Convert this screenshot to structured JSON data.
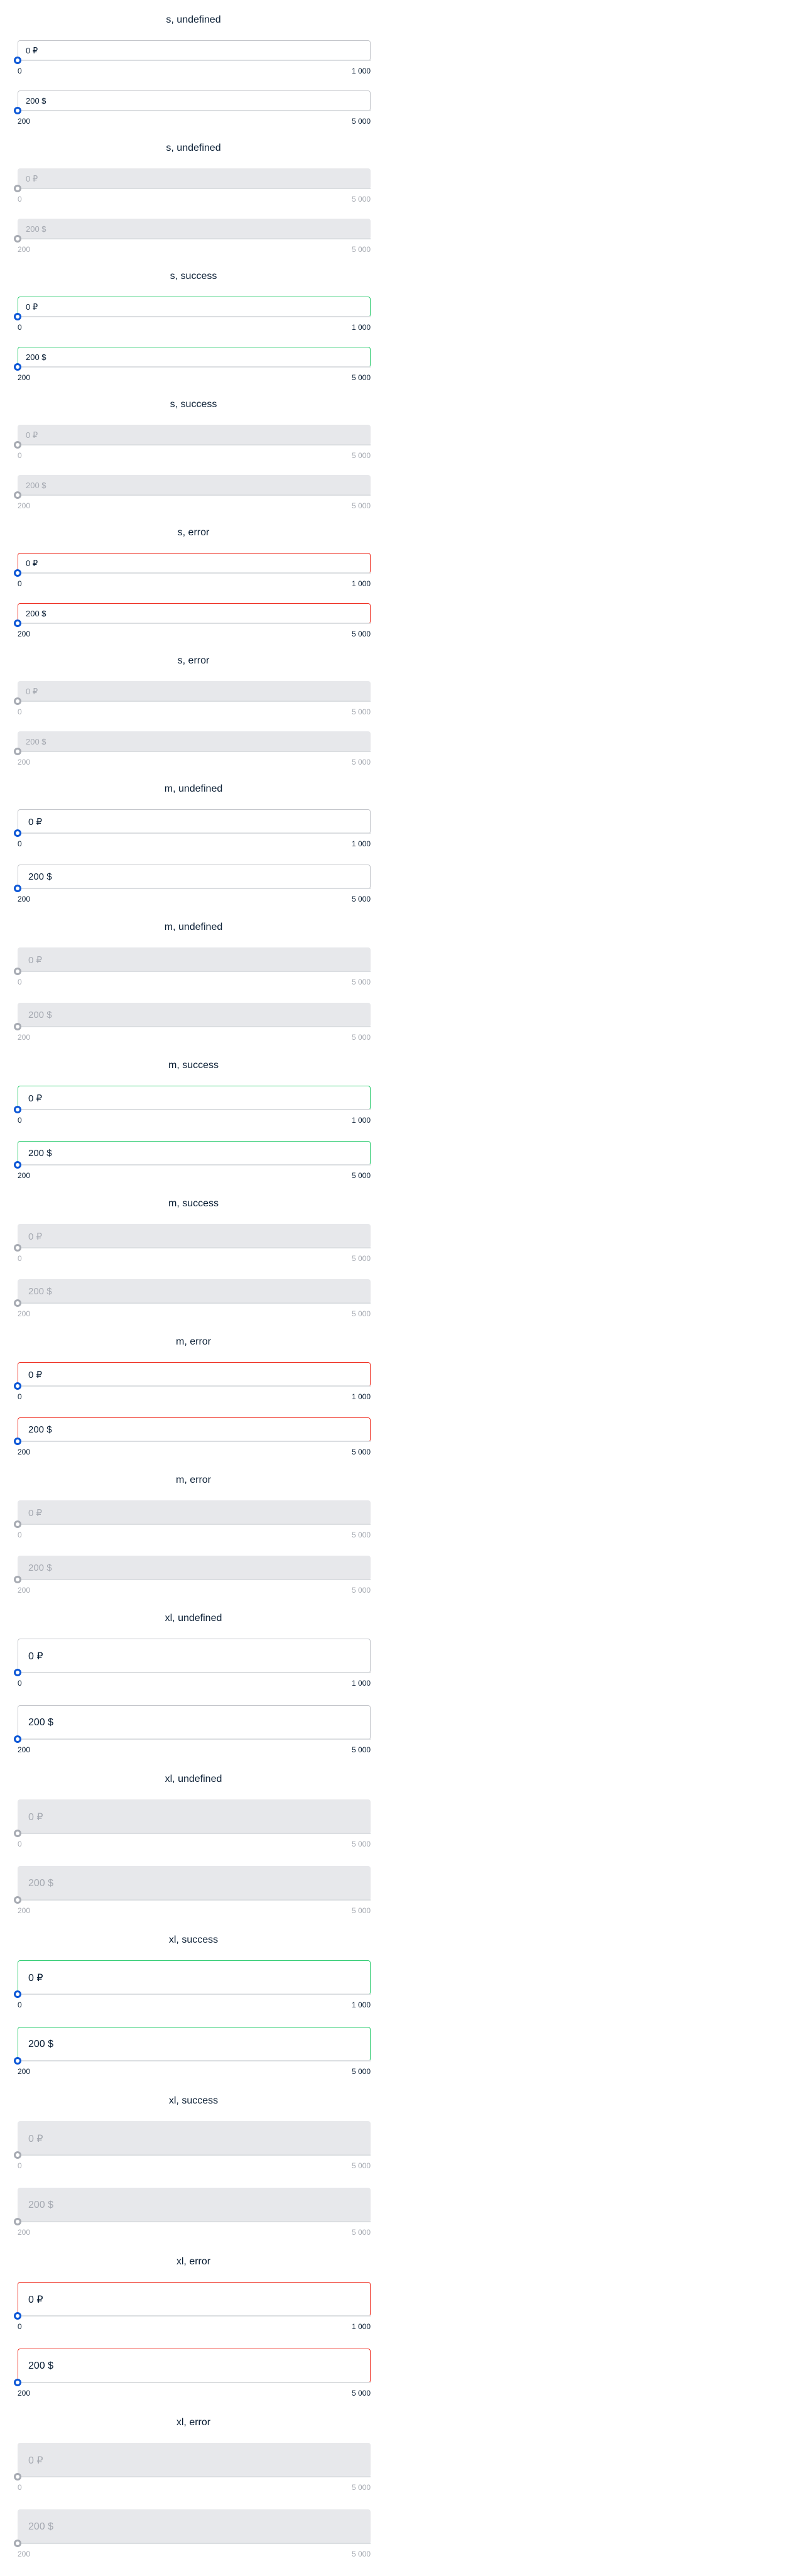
{
  "colors": {
    "text": "#0b1f35",
    "border": "#c4c6cb",
    "success_border": "#2ecc71",
    "error_border": "#ef3124",
    "disabled_bg": "#e7e8eb",
    "disabled_text": "#a6aab2",
    "thumb": "#0b56d6"
  },
  "sections": [
    {
      "title": "s, undefined",
      "size": "s",
      "status": "undefined",
      "disabled": false,
      "rows": [
        {
          "value": "0 ₽",
          "min_label": "0",
          "max_label": "1 000",
          "progress": 0
        },
        {
          "value": "200 $",
          "min_label": "200",
          "max_label": "5 000",
          "progress": 0
        }
      ]
    },
    {
      "title": "s, undefined",
      "size": "s",
      "status": "undefined",
      "disabled": true,
      "rows": [
        {
          "value": "0 ₽",
          "min_label": "0",
          "max_label": "5 000",
          "progress": 0
        },
        {
          "value": "200 $",
          "min_label": "200",
          "max_label": "5 000",
          "progress": 0
        }
      ]
    },
    {
      "title": "s, success",
      "size": "s",
      "status": "success",
      "disabled": false,
      "rows": [
        {
          "value": "0 ₽",
          "min_label": "0",
          "max_label": "1 000",
          "progress": 0
        },
        {
          "value": "200 $",
          "min_label": "200",
          "max_label": "5 000",
          "progress": 0
        }
      ]
    },
    {
      "title": "s, success",
      "size": "s",
      "status": "success",
      "disabled": true,
      "rows": [
        {
          "value": "0 ₽",
          "min_label": "0",
          "max_label": "5 000",
          "progress": 0
        },
        {
          "value": "200 $",
          "min_label": "200",
          "max_label": "5 000",
          "progress": 0
        }
      ]
    },
    {
      "title": "s, error",
      "size": "s",
      "status": "error",
      "disabled": false,
      "rows": [
        {
          "value": "0 ₽",
          "min_label": "0",
          "max_label": "1 000",
          "progress": 0
        },
        {
          "value": "200 $",
          "min_label": "200",
          "max_label": "5 000",
          "progress": 0
        }
      ]
    },
    {
      "title": "s, error",
      "size": "s",
      "status": "error",
      "disabled": true,
      "rows": [
        {
          "value": "0 ₽",
          "min_label": "0",
          "max_label": "5 000",
          "progress": 0
        },
        {
          "value": "200 $",
          "min_label": "200",
          "max_label": "5 000",
          "progress": 0
        }
      ]
    },
    {
      "title": "m, undefined",
      "size": "m",
      "status": "undefined",
      "disabled": false,
      "rows": [
        {
          "value": "0 ₽",
          "min_label": "0",
          "max_label": "1 000",
          "progress": 0
        },
        {
          "value": "200 $",
          "min_label": "200",
          "max_label": "5 000",
          "progress": 0
        }
      ]
    },
    {
      "title": "m, undefined",
      "size": "m",
      "status": "undefined",
      "disabled": true,
      "rows": [
        {
          "value": "0 ₽",
          "min_label": "0",
          "max_label": "5 000",
          "progress": 0
        },
        {
          "value": "200 $",
          "min_label": "200",
          "max_label": "5 000",
          "progress": 0
        }
      ]
    },
    {
      "title": "m, success",
      "size": "m",
      "status": "success",
      "disabled": false,
      "rows": [
        {
          "value": "0 ₽",
          "min_label": "0",
          "max_label": "1 000",
          "progress": 0
        },
        {
          "value": "200 $",
          "min_label": "200",
          "max_label": "5 000",
          "progress": 0
        }
      ]
    },
    {
      "title": "m, success",
      "size": "m",
      "status": "success",
      "disabled": true,
      "rows": [
        {
          "value": "0 ₽",
          "min_label": "0",
          "max_label": "5 000",
          "progress": 0
        },
        {
          "value": "200 $",
          "min_label": "200",
          "max_label": "5 000",
          "progress": 0
        }
      ]
    },
    {
      "title": "m, error",
      "size": "m",
      "status": "error",
      "disabled": false,
      "rows": [
        {
          "value": "0 ₽",
          "min_label": "0",
          "max_label": "1 000",
          "progress": 0
        },
        {
          "value": "200 $",
          "min_label": "200",
          "max_label": "5 000",
          "progress": 0
        }
      ]
    },
    {
      "title": "m, error",
      "size": "m",
      "status": "error",
      "disabled": true,
      "rows": [
        {
          "value": "0 ₽",
          "min_label": "0",
          "max_label": "5 000",
          "progress": 0
        },
        {
          "value": "200 $",
          "min_label": "200",
          "max_label": "5 000",
          "progress": 0
        }
      ]
    },
    {
      "title": "xl, undefined",
      "size": "xl",
      "status": "undefined",
      "disabled": false,
      "rows": [
        {
          "value": "0 ₽",
          "min_label": "0",
          "max_label": "1 000",
          "progress": 0
        },
        {
          "value": "200 $",
          "min_label": "200",
          "max_label": "5 000",
          "progress": 0
        }
      ]
    },
    {
      "title": "xl, undefined",
      "size": "xl",
      "status": "undefined",
      "disabled": true,
      "rows": [
        {
          "value": "0 ₽",
          "min_label": "0",
          "max_label": "5 000",
          "progress": 0
        },
        {
          "value": "200 $",
          "min_label": "200",
          "max_label": "5 000",
          "progress": 0
        }
      ]
    },
    {
      "title": "xl, success",
      "size": "xl",
      "status": "success",
      "disabled": false,
      "rows": [
        {
          "value": "0 ₽",
          "min_label": "0",
          "max_label": "1 000",
          "progress": 0
        },
        {
          "value": "200 $",
          "min_label": "200",
          "max_label": "5 000",
          "progress": 0
        }
      ]
    },
    {
      "title": "xl, success",
      "size": "xl",
      "status": "success",
      "disabled": true,
      "rows": [
        {
          "value": "0 ₽",
          "min_label": "0",
          "max_label": "5 000",
          "progress": 0
        },
        {
          "value": "200 $",
          "min_label": "200",
          "max_label": "5 000",
          "progress": 0
        }
      ]
    },
    {
      "title": "xl, error",
      "size": "xl",
      "status": "error",
      "disabled": false,
      "rows": [
        {
          "value": "0 ₽",
          "min_label": "0",
          "max_label": "1 000",
          "progress": 0
        },
        {
          "value": "200 $",
          "min_label": "200",
          "max_label": "5 000",
          "progress": 0
        }
      ]
    },
    {
      "title": "xl, error",
      "size": "xl",
      "status": "error",
      "disabled": true,
      "rows": [
        {
          "value": "0 ₽",
          "min_label": "0",
          "max_label": "5 000",
          "progress": 0
        },
        {
          "value": "200 $",
          "min_label": "200",
          "max_label": "5 000",
          "progress": 0
        }
      ]
    }
  ]
}
